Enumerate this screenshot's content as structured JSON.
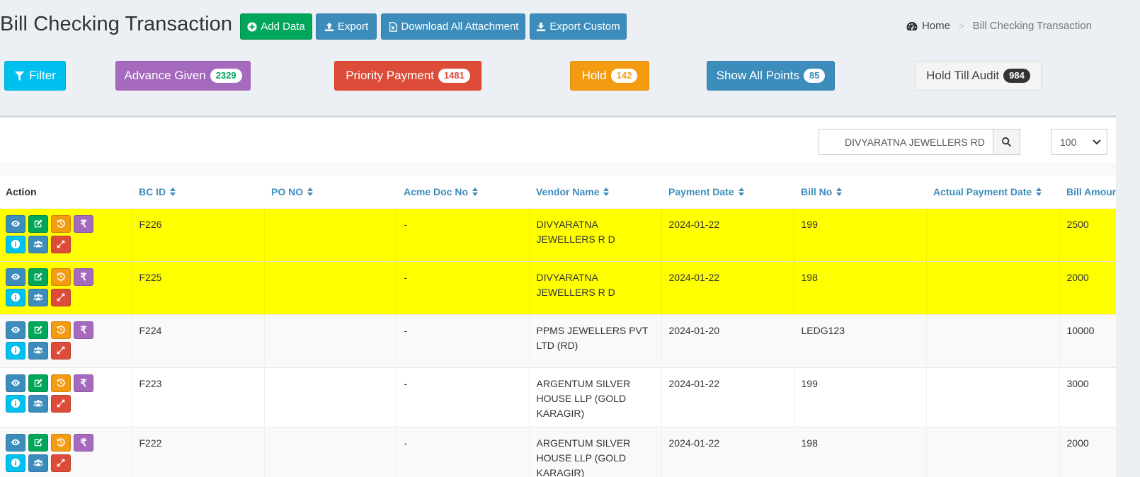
{
  "header": {
    "title": "Bill Checking Transaction",
    "buttons": {
      "add": "Add Data",
      "export": "Export",
      "download": "Download All Attachment",
      "export_custom": "Export Custom"
    },
    "breadcrumb": {
      "home": "Home",
      "sep": ">",
      "current": "Bill Checking Transaction"
    }
  },
  "filters": {
    "filter": "Filter",
    "advance": {
      "label": "Advance Given",
      "count": "2329"
    },
    "priority": {
      "label": "Priority Payment",
      "count": "1481"
    },
    "hold": {
      "label": "Hold",
      "count": "142"
    },
    "showall": {
      "label": "Show All Points",
      "count": "85"
    },
    "holdaudit": {
      "label": "Hold Till Audit",
      "count": "984"
    }
  },
  "search": {
    "value": "DIVYARATNA JEWELLERS RD"
  },
  "page_size": "100",
  "table": {
    "columns": [
      "Action",
      "BC ID",
      "PO NO",
      "Acme Doc No",
      "Vendor Name",
      "Payment Date",
      "Bill No",
      "Actual Payment Date",
      "Bill Amount"
    ],
    "rows": [
      {
        "bc_id": "F226",
        "po_no": "",
        "acme_doc": "-",
        "vendor": "DIVYARATNA JEWELLERS R D",
        "payment_date": "2024-01-22",
        "bill_no": "199",
        "actual_date": "",
        "amount": "2500",
        "highlight": true
      },
      {
        "bc_id": "F225",
        "po_no": "",
        "acme_doc": "-",
        "vendor": "DIVYARATNA JEWELLERS R D",
        "payment_date": "2024-01-22",
        "bill_no": "198",
        "actual_date": "",
        "amount": "2000",
        "highlight": true
      },
      {
        "bc_id": "F224",
        "po_no": "",
        "acme_doc": "-",
        "vendor": "PPMS JEWELLERS PVT LTD (RD)",
        "payment_date": "2024-01-20",
        "bill_no": "LEDG123",
        "actual_date": "",
        "amount": "10000",
        "highlight": false
      },
      {
        "bc_id": "F223",
        "po_no": "",
        "acme_doc": "-",
        "vendor": "ARGENTUM SILVER HOUSE LLP (GOLD KARAGIR)",
        "payment_date": "2024-01-22",
        "bill_no": "199",
        "actual_date": "",
        "amount": "3000",
        "highlight": false
      },
      {
        "bc_id": "F222",
        "po_no": "",
        "acme_doc": "-",
        "vendor": "ARGENTUM SILVER HOUSE LLP (GOLD KARAGIR)",
        "payment_date": "2024-01-22",
        "bill_no": "198",
        "actual_date": "",
        "amount": "2000",
        "highlight": false
      }
    ]
  },
  "icons": {
    "row_actions": [
      "eye-icon",
      "edit-icon",
      "history-icon",
      "rupee-icon",
      "info-icon",
      "users-icon",
      "expand-icon"
    ]
  },
  "colors": {
    "highlight": "#ffff00",
    "primary": "#3c8dbc",
    "success": "#00a65a",
    "warning": "#f39c12",
    "danger": "#dd4b39",
    "purple": "#a569bd",
    "info": "#00c0ef"
  }
}
